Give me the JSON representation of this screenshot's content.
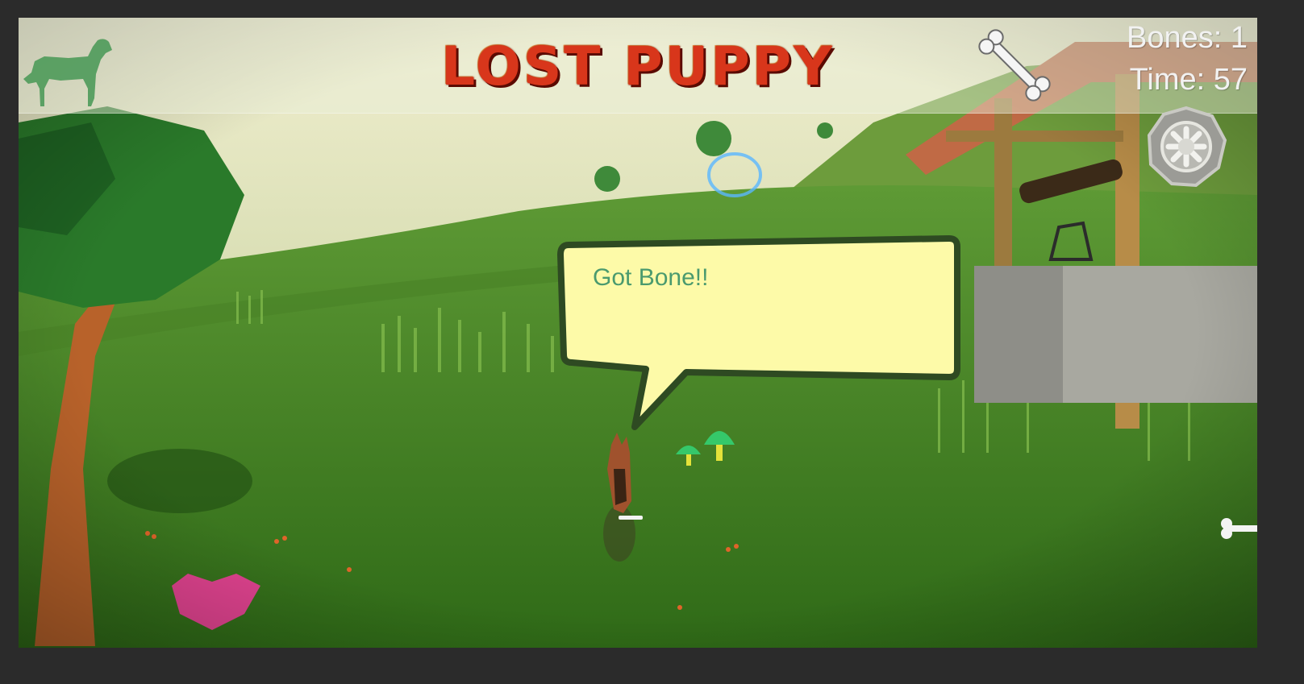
{
  "window": {
    "title": "Game View"
  },
  "hud": {
    "title": "LOST PUPPY",
    "bones_label": "Bones: 1",
    "time_label": "Time: 57",
    "icons": {
      "dog": "dog-silhouette-icon",
      "bone": "bone-icon",
      "settings": "gear-icon"
    }
  },
  "dialog": {
    "message": "Got Bone!!"
  },
  "colors": {
    "title_red": "#d8361b",
    "hud_text": "#f2f2f2",
    "bubble_fill": "#fdfaa8",
    "bubble_text": "#4a9a6e",
    "grass": "#3c7a1f"
  }
}
